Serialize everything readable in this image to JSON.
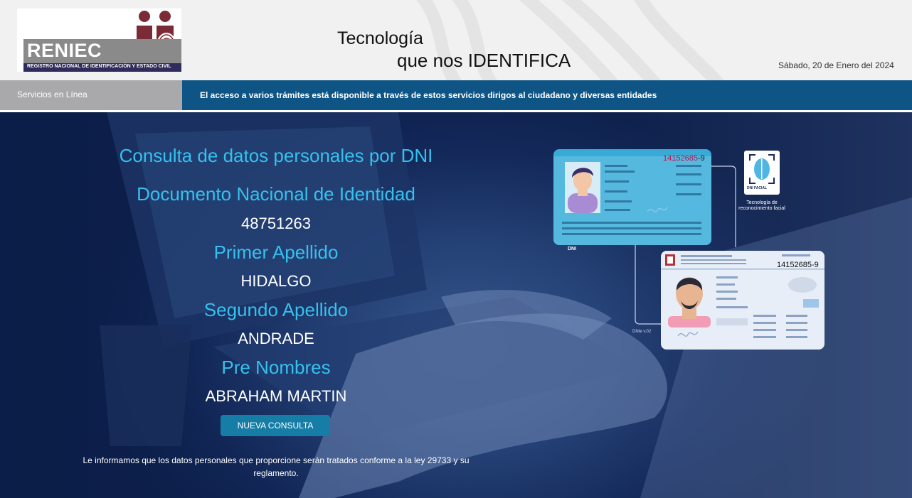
{
  "header": {
    "logo_text": "RENIEC",
    "logo_subtitle": "REGISTRO NACIONAL DE IDENTIFICACIÓN Y ESTADO CIVIL",
    "tagline_line1": "Tecnología",
    "tagline_line2_prefix": "que nos",
    "tagline_line2_strong": "IDENTIFICA",
    "date": "Sábado, 20 de Enero del 2024"
  },
  "band": {
    "left_label": "Servicios en Línea",
    "description": "El acceso a varios trámites está disponible a través de estos servicios dirigos al ciudadano y diversas entidades"
  },
  "result": {
    "title": "Consulta de datos personales por DNI",
    "fields": [
      {
        "label": "Documento Nacional de Identidad",
        "value": "48751263"
      },
      {
        "label": "Primer Apellido",
        "value": "HIDALGO"
      },
      {
        "label": "Segundo Apellido",
        "value": "ANDRADE"
      },
      {
        "label": "Pre Nombres",
        "value": "ABRAHAM MARTIN"
      }
    ],
    "button_label": "NUEVA CONSULTA",
    "notice": "Le informamos que los datos personales que proporcione serán tratados conforme a la ley 29733 y su reglamento."
  },
  "illustration": {
    "card_a_number_red": "14152685",
    "card_a_number_suffix": "-9",
    "card_a_label": "DNI",
    "card_b_number": "14152685-9",
    "card_b_label": "DNIe v.02",
    "facial_tag": "DNI FACIAL",
    "facial_caption": "Tecnología de reconocimiento facial"
  },
  "colors": {
    "accent_cyan": "#35c1ee",
    "band_blue": "#0e5585",
    "band_gray": "#a9a9ab",
    "button": "#167da7",
    "hero_dark": "#0c1f4a"
  }
}
